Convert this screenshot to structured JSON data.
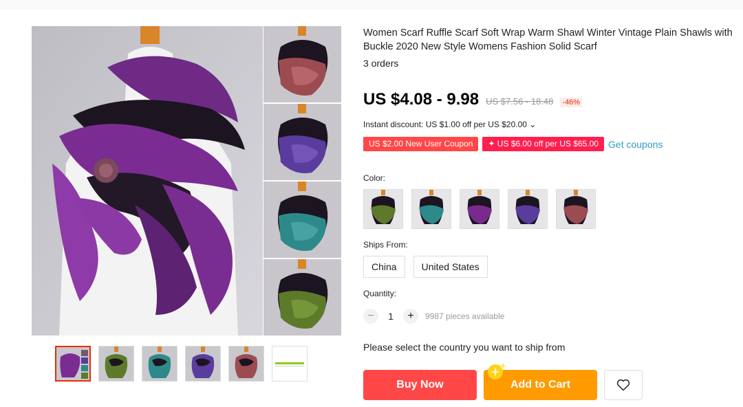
{
  "product": {
    "title": "Women Scarf Ruffle Scarf Soft Wrap Warm Shawl Winter Vintage Plain Shawls with Buckle 2020 New Style Womens Fashion Solid Scarf",
    "orders": "3 orders"
  },
  "price": {
    "current": "US $4.08 - 9.98",
    "original": "US $7.56 - 18.48",
    "discount": "-46%"
  },
  "promo": {
    "instant_discount": "Instant discount: US $1.00 off per US $20.00 ⌄",
    "coupon_new_user": "US $2.00 New User Coupon",
    "coupon_store": "✦ US $6.00 off per US $65.00",
    "get_coupons": "Get coupons"
  },
  "color": {
    "label": "Color:",
    "options": [
      "green",
      "teal",
      "purple",
      "violet",
      "rose"
    ]
  },
  "ships_from": {
    "label": "Ships From:",
    "options": [
      "China",
      "United States"
    ]
  },
  "quantity": {
    "label": "Quantity:",
    "minus": "−",
    "value": "1",
    "plus": "+",
    "available": "9987 pieces available"
  },
  "notice": "Please select the country you want to ship from",
  "actions": {
    "buy_now": "Buy Now",
    "add_to_cart": "Add to Cart",
    "wishlist_icon": "heart-icon"
  },
  "colors": {
    "price_red": "#ff4747",
    "cart_orange": "#ff9a00",
    "link_blue": "#2e9cc3",
    "scarf_purple": "#7a2a8c",
    "scarf_green": "#5d7a2a",
    "scarf_teal": "#2e8a8a",
    "scarf_violet": "#5a3c9e",
    "scarf_rose": "#9c4c50"
  }
}
